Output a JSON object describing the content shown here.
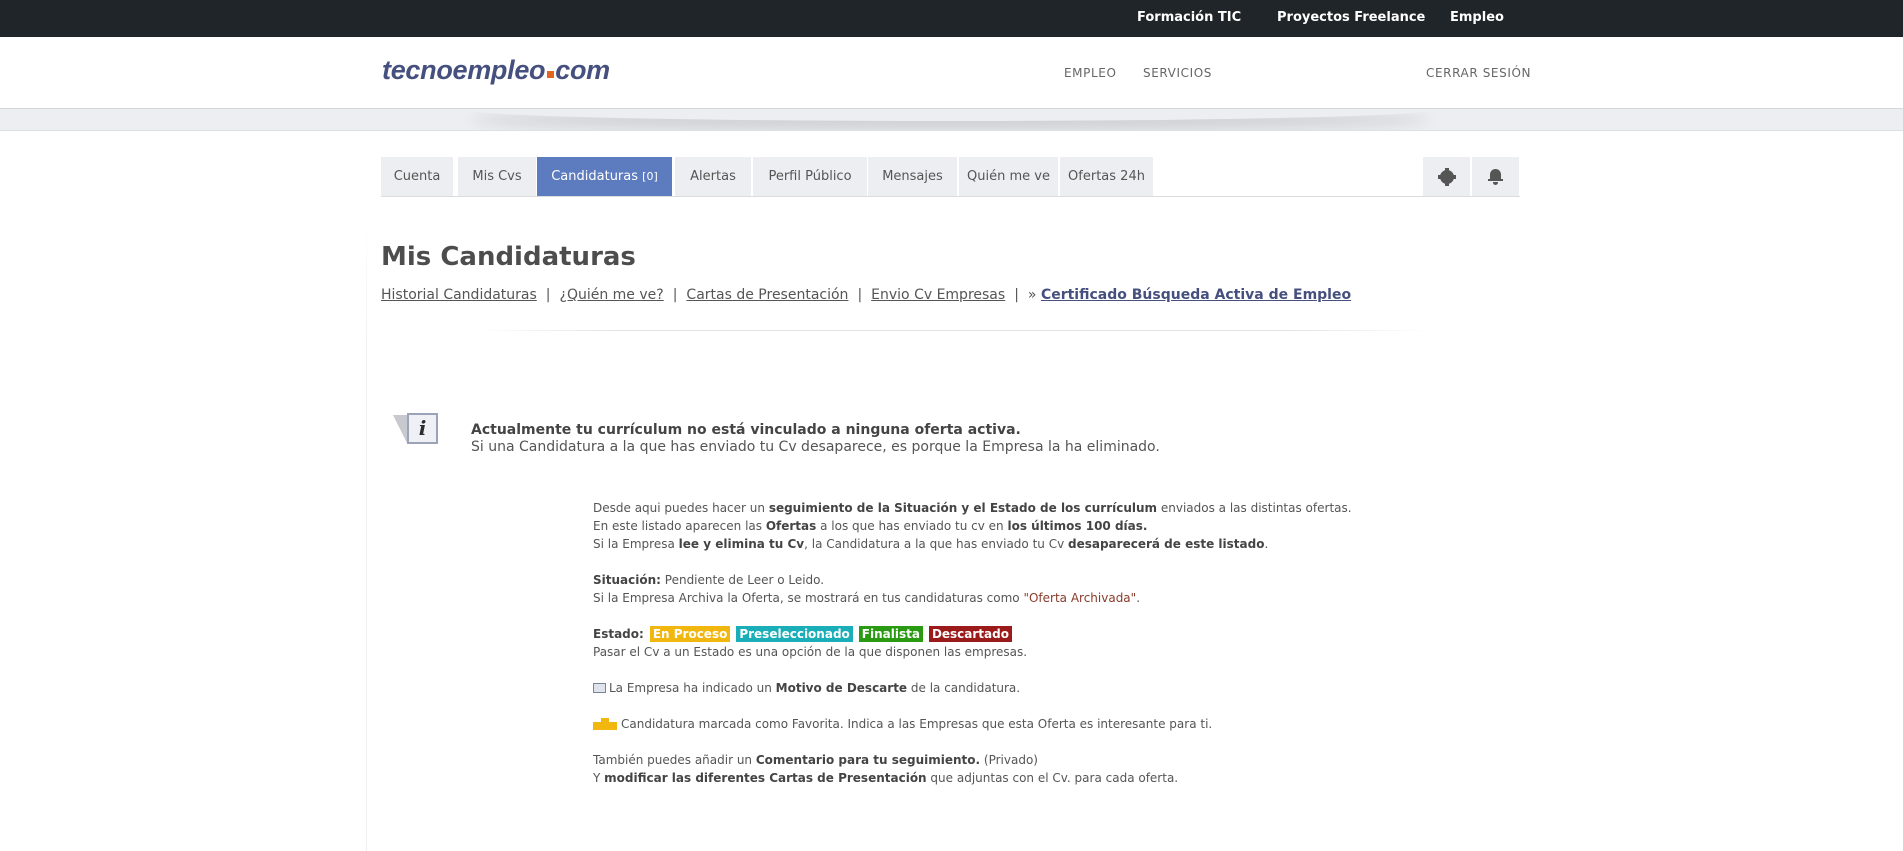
{
  "topbar": {
    "links": [
      "Formación TIC",
      "Proyectos Freelance",
      "Empleo"
    ]
  },
  "header": {
    "logo_main": "tecnoempleo",
    "logo_suffix": "com",
    "nav": [
      "EMPLEO",
      "SERVICIOS"
    ],
    "logout": "CERRAR SESIÓN"
  },
  "tabs": {
    "items": [
      "Cuenta",
      "Mis Cvs",
      "Candidaturas",
      "Alertas",
      "Perfil Público",
      "Mensajes",
      "Quién me ve",
      "Ofertas 24h"
    ],
    "active_count": "[0]",
    "icons": [
      "gear-icon",
      "bell-icon"
    ]
  },
  "page": {
    "title": "Mis Candidaturas",
    "subnav": [
      "Historial Candidaturas",
      "¿Quién me ve?",
      "Cartas de Presentación",
      "Envio Cv Empresas"
    ],
    "subnav_prefix": "»",
    "subnav_strong": "Certificado Búsqueda Activa de Empleo",
    "separator": "|"
  },
  "notice": {
    "icon_letter": "i",
    "line1": "Actualmente tu currículum no está vinculado a ninguna oferta activa.",
    "line2": "Si una Candidatura a la que has enviado tu Cv desaparece, es porque la Empresa la ha eliminado."
  },
  "help": {
    "p1a": "Desde aqui puedes hacer un ",
    "p1b": "seguimiento de la Situación y el Estado de los currículum",
    "p1c": " enviados a las distintas ofertas.",
    "p2a": "En este listado aparecen las ",
    "p2b": "Ofertas",
    "p2c": " a los que has enviado tu cv en ",
    "p2d": "los últimos 100 días.",
    "p3a": "Si la Empresa ",
    "p3b": "lee y elimina tu Cv",
    "p3c": ", la Candidatura a la que has enviado tu Cv ",
    "p3d": "desaparecerá de este listado",
    "p3e": ".",
    "sit_label": "Situación:",
    "sit_value": " Pendiente de Leer o Leido.",
    "arch_a": "Si la Empresa Archiva la Oferta, se mostrará en tus candidaturas como ",
    "arch_b": "\"Oferta Archivada\"",
    "arch_c": ".",
    "estado_label": "Estado:",
    "badges": [
      "En Proceso",
      "Preseleccionado",
      "Finalista",
      "Descartado"
    ],
    "badge_colors": [
      "#f2b70f",
      "#1aaeb8",
      "#2a9a13",
      "#9b1b1b"
    ],
    "estado_note": "Pasar el Cv a un Estado es una opción de la que disponen las empresas.",
    "motivo_a": "La Empresa ha indicado un ",
    "motivo_b": "Motivo de Descarte",
    "motivo_c": " de la candidatura.",
    "fav": "Candidatura marcada como Favorita. Indica a las Empresas que esta Oferta es interesante para ti.",
    "com_a": "También puedes añadir un ",
    "com_b": "Comentario para tu seguimiento.",
    "com_c": " (Privado)",
    "mod_a": "Y ",
    "mod_b": "modificar las diferentes Cartas de Presentación",
    "mod_c": " que adjuntas con el Cv. para cada oferta."
  }
}
